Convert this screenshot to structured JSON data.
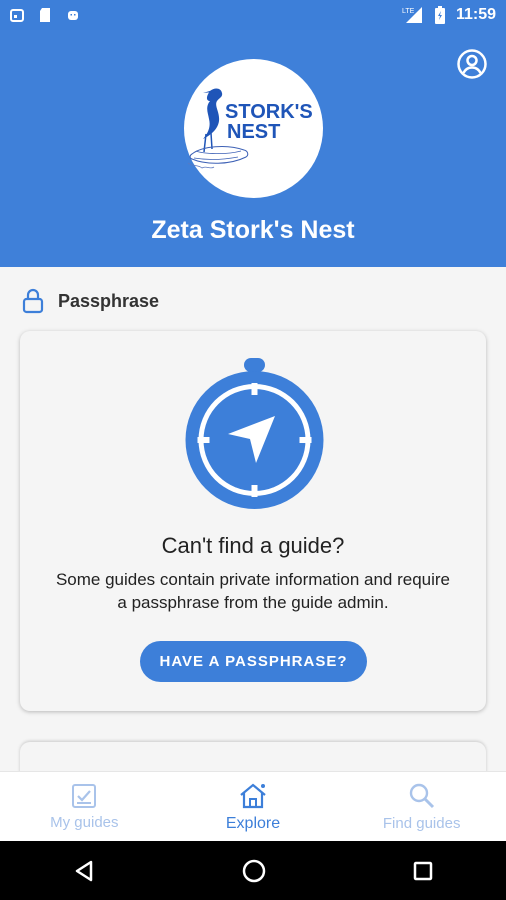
{
  "status": {
    "time": "11:59",
    "network": "LTE"
  },
  "header": {
    "logo_line1": "STORK'S",
    "logo_line2": "NEST",
    "title": "Zeta Stork's Nest"
  },
  "section": {
    "label": "Passphrase"
  },
  "card": {
    "title": "Can't find a guide?",
    "body": "Some guides contain private information and require a passphrase from the guide admin.",
    "button_label": "HAVE A PASSPHRASE?"
  },
  "bottom_nav": {
    "items": [
      {
        "label": "My guides",
        "icon": "checklist-icon",
        "state": "inactive"
      },
      {
        "label": "Explore",
        "icon": "home-icon",
        "state": "active"
      },
      {
        "label": "Find guides",
        "icon": "search-icon",
        "state": "inactive"
      }
    ]
  },
  "colors": {
    "primary": "#3d7fd9",
    "nav_inactive": "#a9c3ea"
  }
}
